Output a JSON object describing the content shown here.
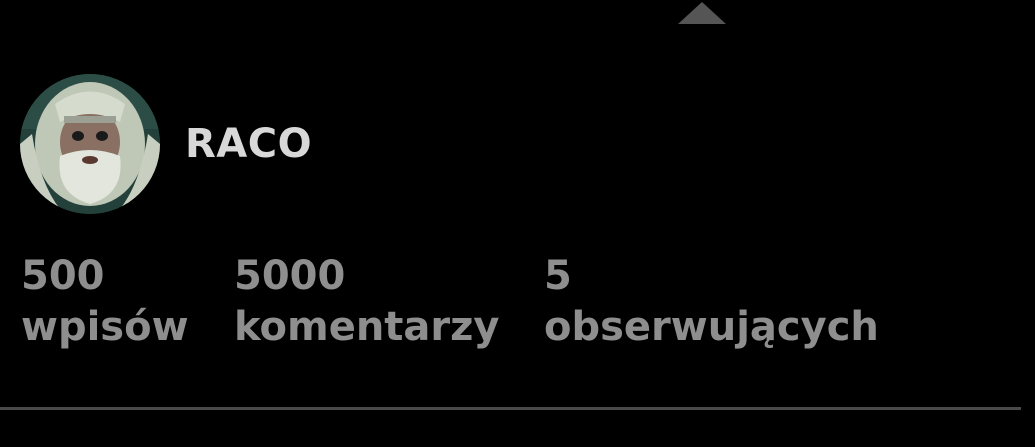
{
  "profile": {
    "username": "RACO",
    "avatar_icon": "user-avatar-photo"
  },
  "stats": [
    {
      "value": "500",
      "label": "wpisów"
    },
    {
      "value": "5000",
      "label": "komentarzy"
    },
    {
      "value": "5",
      "label": "obserwujących"
    }
  ],
  "colors": {
    "background": "#000000",
    "username": "#d8d8d8",
    "stats": "#8e8e8e",
    "divider": "#4a4a4a",
    "caret": "#555555"
  }
}
